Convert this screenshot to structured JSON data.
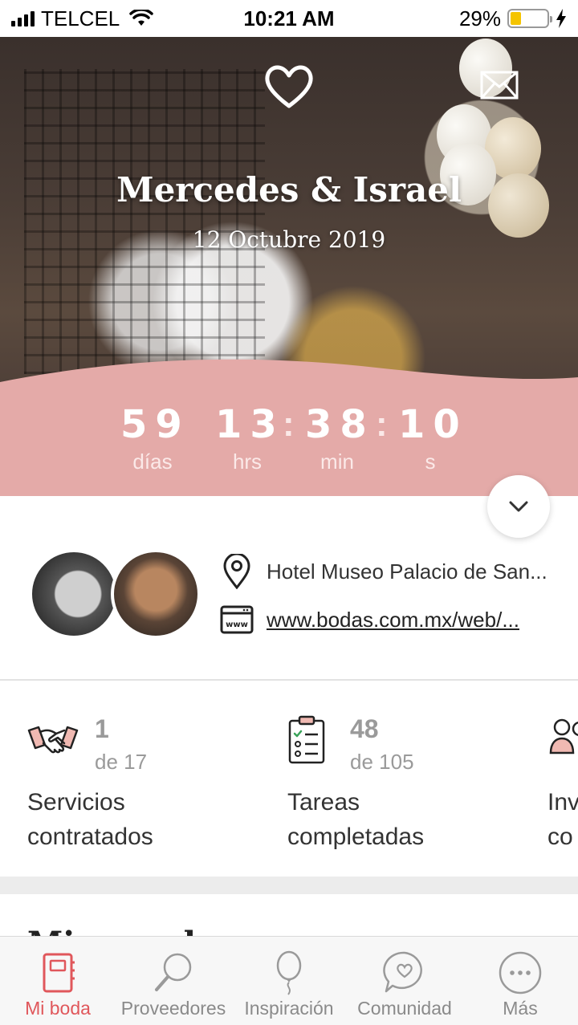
{
  "status_bar": {
    "carrier": "TELCEL",
    "time": "10:21 AM",
    "battery_percent": "29%",
    "battery_level": 0.29,
    "icons": [
      "signal-icon",
      "wifi-icon",
      "battery-icon",
      "charging-icon"
    ]
  },
  "hero": {
    "title": "Mercedes & Israel",
    "date": "12 Octubre 2019",
    "icons": [
      "heart-logo-icon",
      "envelope-icon"
    ]
  },
  "countdown": {
    "days": "59",
    "days_label": "días",
    "hours": "13",
    "hours_label": "hrs",
    "minutes": "38",
    "minutes_label": "min",
    "seconds": "10",
    "seconds_label": "s"
  },
  "couple": {
    "venue": "Hotel Museo Palacio de San...",
    "website": "www.bodas.com.mx/web/..."
  },
  "stats": [
    {
      "value": "1",
      "total": "de 17",
      "label_line1": "Servicios",
      "label_line2": "contratados",
      "icon": "handshake-icon"
    },
    {
      "value": "48",
      "total": "de 105",
      "label_line1": "Tareas",
      "label_line2": "completadas",
      "icon": "checklist-icon"
    },
    {
      "value": "",
      "total": "",
      "label_line1": "Inv",
      "label_line2": "co",
      "icon": "guests-icon"
    }
  ],
  "section": {
    "title": "Mi agenda"
  },
  "tabbar": {
    "items": [
      {
        "label": "Mi boda",
        "icon": "notebook-icon",
        "active": true
      },
      {
        "label": "Proveedores",
        "icon": "magnifier-icon",
        "active": false
      },
      {
        "label": "Inspiración",
        "icon": "balloon-icon",
        "active": false
      },
      {
        "label": "Comunidad",
        "icon": "chat-heart-icon",
        "active": false
      },
      {
        "label": "Más",
        "icon": "more-icon",
        "active": false
      }
    ]
  },
  "colors": {
    "accent": "#e0575b",
    "countdown_band": "#e4aaa8",
    "stat_number": "#9a9a9a"
  }
}
